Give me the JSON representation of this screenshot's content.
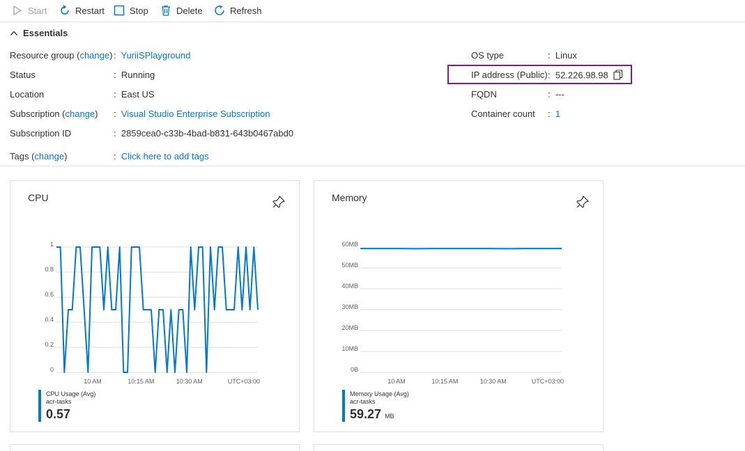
{
  "toolbar": {
    "start": "Start",
    "restart": "Restart",
    "stop": "Stop",
    "delete": "Delete",
    "refresh": "Refresh"
  },
  "essentials": {
    "title": "Essentials",
    "left": {
      "resource_group_label": "Resource group",
      "change_link": "change",
      "resource_group_value": "YuriiSPlayground",
      "status_label": "Status",
      "status_value": "Running",
      "location_label": "Location",
      "location_value": "East US",
      "subscription_label": "Subscription",
      "subscription_value": "Visual Studio Enterprise Subscription",
      "subscription_id_label": "Subscription ID",
      "subscription_id_value": "2859cea0-c33b-4bad-b831-643b0467abd0",
      "tags_label": "Tags",
      "tags_value": "Click here to add tags"
    },
    "right": {
      "os_type_label": "OS type",
      "os_type_value": "Linux",
      "ip_label": "IP address (Public)",
      "ip_value": "52.226.98.98",
      "fqdn_label": "FQDN",
      "fqdn_value": "---",
      "container_count_label": "Container count",
      "container_count_value": "1"
    }
  },
  "colors": {
    "accent": "#0078d4",
    "highlight_border": "#7b1f86"
  },
  "chart_data": [
    {
      "type": "line",
      "title": "CPU",
      "y_ticks": [
        "1",
        "0.8",
        "0.6",
        "0.4",
        "0.2",
        "0"
      ],
      "ylim": [
        0,
        1
      ],
      "x_ticks": [
        "10 AM",
        "10:15 AM",
        "10:30 AM",
        "UTC+03:00"
      ],
      "x_tick_positions": [
        0.18,
        0.42,
        0.66
      ],
      "series": [
        {
          "name": "CPU Usage (Avg)",
          "resource": "acr-tasks",
          "summary_value": "0.57",
          "color": "#0078d4",
          "values": [
            1,
            1,
            0,
            0.5,
            0.5,
            1,
            1,
            0.5,
            0,
            1,
            1,
            1,
            0.5,
            1,
            0.5,
            0.5,
            1,
            0,
            0,
            1,
            1,
            1,
            0.5,
            0.5,
            0.5,
            0,
            0.5,
            0.5,
            0,
            0.5,
            0,
            0.5,
            0.5,
            0,
            1,
            0.5,
            1,
            1,
            0,
            1,
            0.5,
            1,
            1,
            0.5,
            0.5,
            0.5,
            1,
            0.5,
            1,
            0.5,
            1,
            0.5
          ]
        }
      ]
    },
    {
      "type": "line",
      "title": "Memory",
      "y_ticks": [
        "60MB",
        "50MB",
        "40MB",
        "30MB",
        "20MB",
        "10MB",
        "0B"
      ],
      "ylim": [
        0,
        60
      ],
      "x_ticks": [
        "10 AM",
        "10:15 AM",
        "10:30 AM",
        "UTC+03:00"
      ],
      "x_tick_positions": [
        0.18,
        0.42,
        0.66
      ],
      "series": [
        {
          "name": "Memory Usage (Avg)",
          "resource": "acr-tasks",
          "summary_value": "59.27",
          "summary_unit": "MB",
          "color": "#0078d4",
          "values": [
            59.3,
            59.3,
            59.3,
            59.2,
            59.3,
            59.3,
            59.3,
            59.3,
            59.2,
            59.3,
            59.3,
            59.3
          ]
        }
      ]
    }
  ]
}
